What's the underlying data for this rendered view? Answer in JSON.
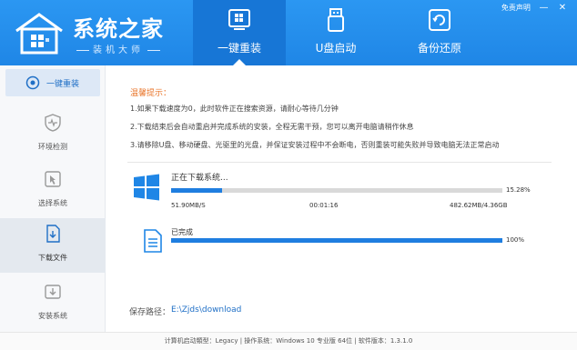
{
  "app": {
    "title": "系统之家",
    "subtitle": "装机大师"
  },
  "header": {
    "tabs": [
      {
        "label": "一键重装",
        "icon": "windows-install-icon",
        "active": true
      },
      {
        "label": "U盘启动",
        "icon": "usb-drive-icon",
        "active": false
      },
      {
        "label": "备份还原",
        "icon": "backup-restore-icon",
        "active": false
      }
    ],
    "feedback_label": "免责声明",
    "minimize_glyph": "—",
    "close_glyph": "✕"
  },
  "sidebar": {
    "items": [
      {
        "label": "一键重装",
        "icon": "reinstall-icon"
      },
      {
        "label": "环境检测",
        "icon": "environment-check-icon"
      },
      {
        "label": "选择系统",
        "icon": "select-system-icon"
      },
      {
        "label": "下载文件",
        "icon": "download-file-icon"
      },
      {
        "label": "安装系统",
        "icon": "install-system-icon"
      }
    ]
  },
  "tips": {
    "title": "温馨提示：",
    "lines": [
      "1.如果下载速度为0，此时软件正在搜索资源，请耐心等待几分钟",
      "2.下载结束后会自动重启并完成系统的安装，全程无需干预，您可以离开电脑请稍作休息",
      "3.请移除U盘、移动硬盘、光驱里的光盘，并保证安装过程中不会断电，否则重装可能失败并导致电脑无法正常启动"
    ]
  },
  "download": {
    "title": "正在下载系统...",
    "progress": 0.1528,
    "percent_text": "15.28%",
    "speed": "51.90MB/S",
    "elapsed": "00:01:16",
    "size": "482.62MB/4.36GB"
  },
  "completed": {
    "title": "已完成",
    "progress": 1.0,
    "percent_text": "100%"
  },
  "save": {
    "label": "保存路径：",
    "path": "E:\\Zjds\\download"
  },
  "footer": {
    "text": "计算机启动類型：Legacy | 操作系统：Windows 10 专业版 64位 | 软件版本：1.3.1.0"
  },
  "colors": {
    "header": "#1f86e6",
    "header_active_tab": "#1776d6",
    "progress": "#1f7ee0",
    "tips_title": "#e9762b",
    "link": "#1f6fc6"
  }
}
